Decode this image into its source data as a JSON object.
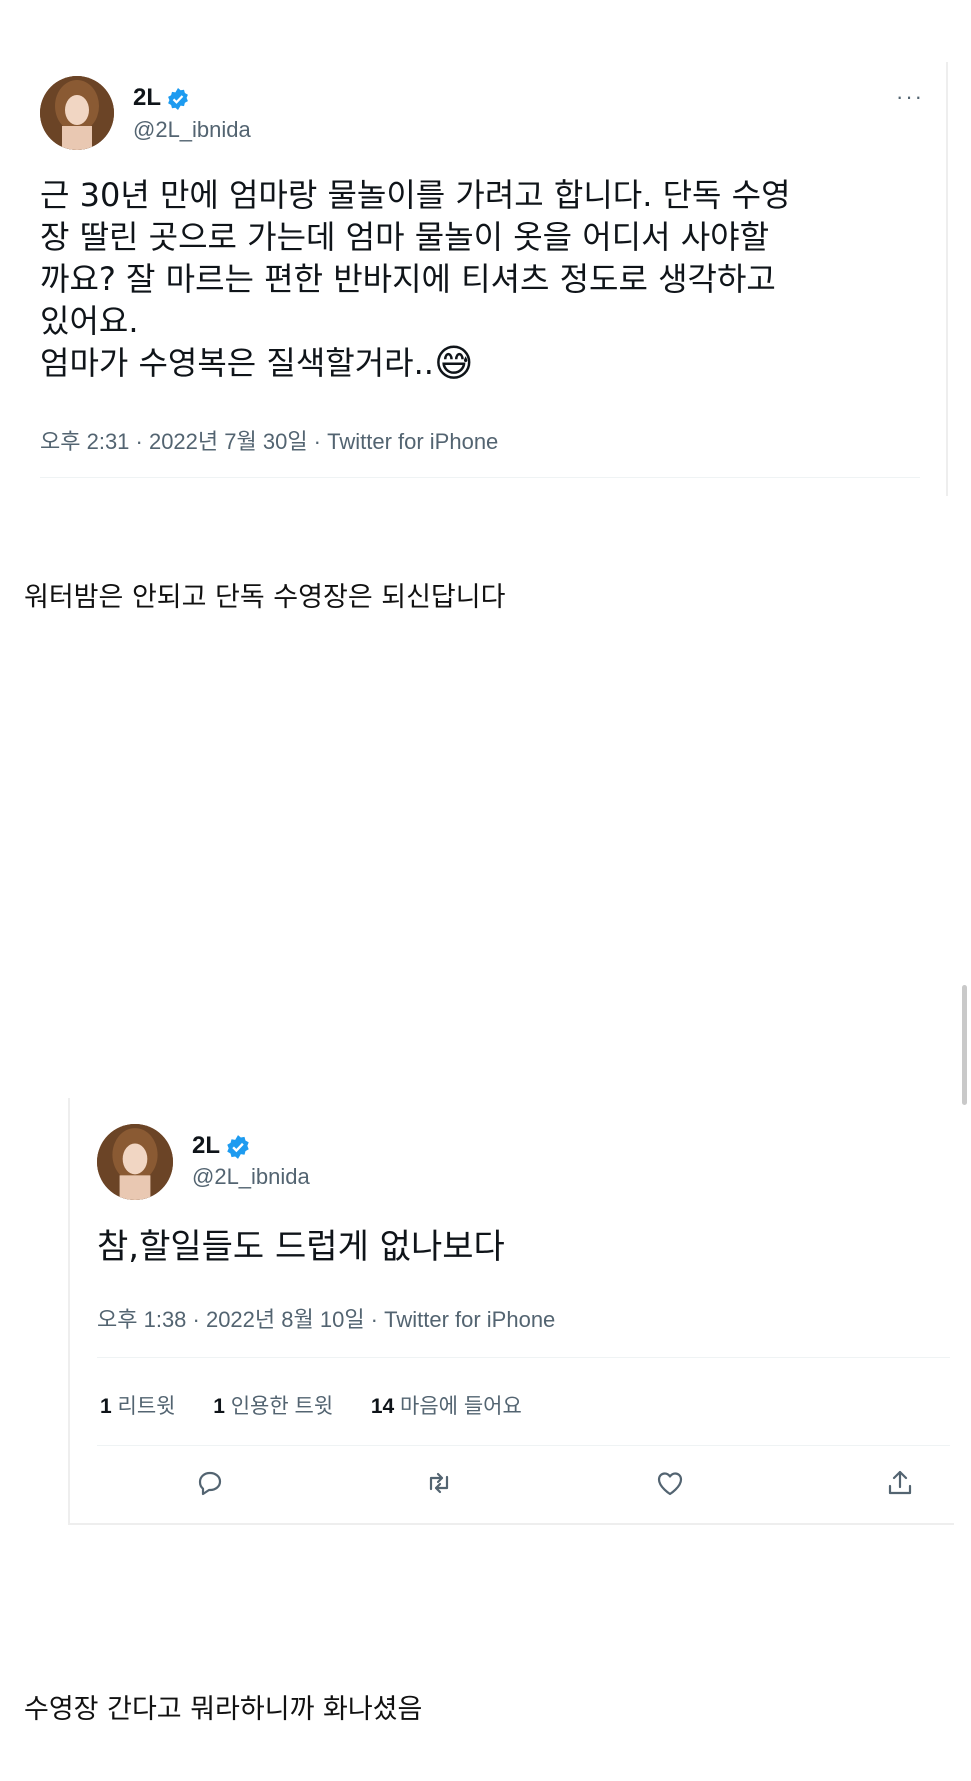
{
  "tweet1": {
    "name": "2L",
    "handle": "@2L_ibnida",
    "more": "···",
    "text": "근 30년 만에 엄마랑 물놀이를 가려고 합니다. 단독 수영\n장 딸린 곳으로 가는데 엄마 물놀이 옷을 어디서 사야할\n까요? 잘 마르는 편한 반바지에 티셔츠 정도로 생각하고\n있어요.\n엄마가 수영복은 질색할거라..",
    "emoji": "😅",
    "meta": "오후 2:31 · 2022년 7월 30일 · Twitter for iPhone"
  },
  "caption1": "워터밤은 안되고 단독 수영장은 되신답니다",
  "tweet2": {
    "name": "2L",
    "handle": "@2L_ibnida",
    "text": "참,할일들도 드럽게 없나보다",
    "meta": "오후 1:38 · 2022년 8월 10일 · Twitter for iPhone",
    "stats": {
      "retweets_count": "1",
      "retweets_label": "리트윗",
      "quotes_count": "1",
      "quotes_label": "인용한 트윗",
      "likes_count": "14",
      "likes_label": "마음에 들어요"
    },
    "actions": [
      "reply-icon",
      "retweet-icon",
      "like-icon",
      "share-icon"
    ]
  },
  "caption2": "수영장 간다고 뭐라하니까 화나셨음",
  "colors": {
    "verified": "#1d9bf0",
    "secondary_text": "#536471",
    "divider": "#eff3f4"
  }
}
